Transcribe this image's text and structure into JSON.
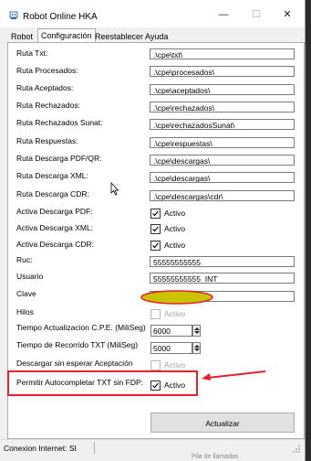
{
  "window": {
    "title": "Robot Online HKA",
    "minimize_glyph": "—",
    "maximize_glyph": "☐",
    "close_glyph": "✕"
  },
  "tabs": [
    {
      "label": "Robot",
      "active": false
    },
    {
      "label": "Configuración",
      "active": true
    },
    {
      "label": "Reestablecer",
      "active": false
    },
    {
      "label": "Ayuda",
      "active": false
    }
  ],
  "paths": [
    {
      "label": "Ruta Txt:",
      "value": ".\\cpe\\txt\\"
    },
    {
      "label": "Ruta Procesados:",
      "value": ".\\cpe\\procesados\\"
    },
    {
      "label": "Ruta Aceptados:",
      "value": ".\\cpe\\aceptados\\"
    },
    {
      "label": "Ruta Rechazados:",
      "value": ".\\cpe\\rechazados\\"
    },
    {
      "label": "Ruta Rechazados Sunat:",
      "value": ".\\cpe\\rechazadosSunat\\"
    },
    {
      "label": "Ruta Respuestas:",
      "value": ".\\cpe\\respuestas\\"
    },
    {
      "label": "Ruta Descarga PDF/QR:",
      "value": ".\\cpe\\descargas\\"
    },
    {
      "label": "Ruta Descarga XML:",
      "value": ".\\cpe\\descargas\\"
    },
    {
      "label": "Ruta Descarga CDR:",
      "value": ".\\cpe\\descargas\\cdr\\"
    }
  ],
  "downloads": [
    {
      "label": "Activa Descarga PDF:",
      "checked": true,
      "text": "Activo"
    },
    {
      "label": "Activa Descarga XML:",
      "checked": true,
      "text": "Activo"
    },
    {
      "label": "Activa Descarga CDR:",
      "checked": true,
      "text": "Activo"
    }
  ],
  "ruc": {
    "label": "Ruc:",
    "value": "55555555555"
  },
  "usuario": {
    "label": "Usuario",
    "value": "55555555555_INT"
  },
  "clave": {
    "label": "Clave",
    "value": ""
  },
  "hilos": {
    "label": "Hilos",
    "checked": false,
    "text": "Activo",
    "enabled": false
  },
  "tiempo_cpe": {
    "label": "Tiempo Actualizacion C.P.E. (MiliSeg)",
    "value": "6000"
  },
  "tiempo_txt": {
    "label": "Tiempo de Recorrido TXT (MiliSeg)",
    "value": "5000"
  },
  "descargar": {
    "label": "Descargar sin esperar Aceptación",
    "checked": false,
    "text": "Activo",
    "enabled": false
  },
  "autocompletar": {
    "label": "Permitir Autocompletar TXT sin FDP:",
    "checked": true,
    "text": "Activo"
  },
  "actualizar_button": "Actualizar",
  "status": {
    "text": "Conexion Internet: SI"
  },
  "background_text": "Pila de llamadas",
  "colors": {
    "highlight": "#e8202a",
    "redaction": "#c9c400"
  }
}
